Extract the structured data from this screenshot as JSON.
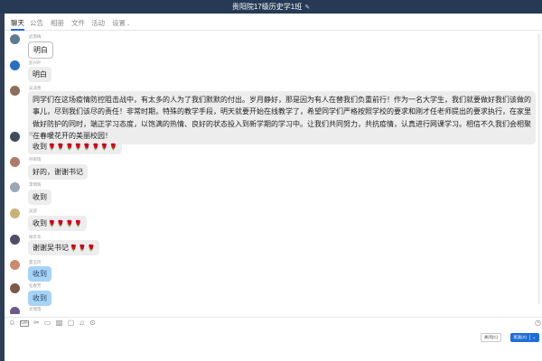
{
  "window": {
    "title": "贵阳院17级历史学1班",
    "edit_icon": "✎"
  },
  "tabs": [
    {
      "label": "聊天",
      "active": true
    },
    {
      "label": "公告"
    },
    {
      "label": "相册"
    },
    {
      "label": "文件"
    },
    {
      "label": "活动"
    },
    {
      "label": "设置",
      "caret": "⌄"
    }
  ],
  "messages": [
    {
      "sender": "武雪梅",
      "text": "明白",
      "roses": 0
    },
    {
      "sender": "彭兴叶",
      "text": "明白",
      "roses": 0
    },
    {
      "sender": "吴迪善",
      "text": "同学们在这场疫情防控阻击战中，有太多的人为了我们默默的付出。岁月静好，那是因为有人在替我们负重前行！作为一名大学生，我们就要做好我们该做的事儿，尽到我们该尽的责任！非常时期，特殊的教学手段，明天就要开始在线教学了，希望同学们严格按照学校的要求和刚才任老师提出的要求执行，在家里做好防护的同时，端正学习态度，以饱满的热情、良好的状态投入到新学期的学习中。让我们共同努力，共抗疫情，认真进行网课学习。相信不久我们会相聚在春暖花开的美丽校园！",
      "roses": 0
    },
    {
      "sender": "周云",
      "text": "收到",
      "roses": 8
    },
    {
      "sender": "孙荣雨",
      "text": "好的，谢谢书记",
      "roses": 0
    },
    {
      "sender": "李明辉",
      "text": "收到",
      "roses": 0
    },
    {
      "sender": "吴舒",
      "text": "收到",
      "roses": 4
    },
    {
      "sender": "杨京华",
      "text": "谢谢吴书记",
      "roses": 3
    },
    {
      "sender": "夏玉玲",
      "text": "收到",
      "roses": 0
    },
    {
      "sender": "任春芳",
      "text": "收到",
      "roses": 0
    },
    {
      "sender": "文瑞雪",
      "text": "",
      "roses": 0
    }
  ],
  "rose_glyph": "🌹",
  "toolbar": {
    "icons": [
      "emoji-icon",
      "gif-icon",
      "scissors-icon",
      "folder-icon",
      "image-icon",
      "screen-icon",
      "bell-icon",
      "more-icon"
    ],
    "history_icon": "clock-icon"
  },
  "actions": {
    "close_label": "关闭(C)",
    "send_label": "发送(S)",
    "send_dropdown": "⌄"
  },
  "colors": {
    "titlebar": "#263a56",
    "accent": "#1f6dd6",
    "bubble": "#ededed",
    "bubble_blue": "#a7d3f7"
  }
}
